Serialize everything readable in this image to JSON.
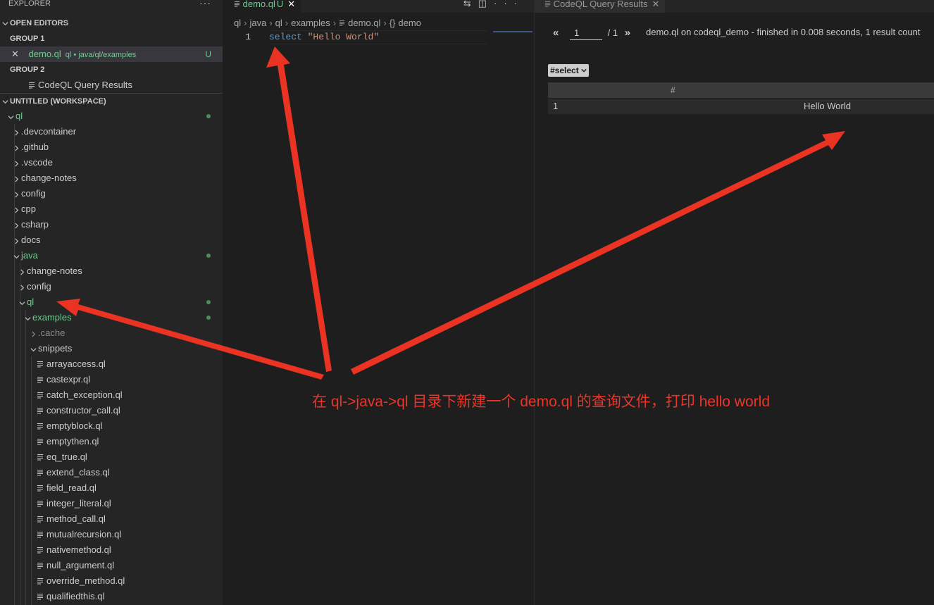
{
  "sidebar": {
    "header": "EXPLORER",
    "more": "···",
    "open_editors_label": "OPEN EDITORS",
    "group1_label": "GROUP 1",
    "group1_file": "demo.ql",
    "group1_hint": "ql • java/ql/examples",
    "group1_badge": "U",
    "group2_label": "GROUP 2",
    "group2_file": "CodeQL Query Results",
    "workspace_label": "UNTITLED (WORKSPACE)",
    "tree": [
      {
        "label": "ql"
      },
      {
        "label": ".devcontainer"
      },
      {
        "label": ".github"
      },
      {
        "label": ".vscode"
      },
      {
        "label": "change-notes"
      },
      {
        "label": "config"
      },
      {
        "label": "cpp"
      },
      {
        "label": "csharp"
      },
      {
        "label": "docs"
      },
      {
        "label": "java"
      },
      {
        "label": "change-notes"
      },
      {
        "label": "config"
      },
      {
        "label": "ql"
      },
      {
        "label": "examples"
      },
      {
        "label": ".cache"
      },
      {
        "label": "snippets"
      },
      {
        "label": "arrayaccess.ql"
      },
      {
        "label": "castexpr.ql"
      },
      {
        "label": "catch_exception.ql"
      },
      {
        "label": "constructor_call.ql"
      },
      {
        "label": "emptyblock.ql"
      },
      {
        "label": "emptythen.ql"
      },
      {
        "label": "eq_true.ql"
      },
      {
        "label": "extend_class.ql"
      },
      {
        "label": "field_read.ql"
      },
      {
        "label": "integer_literal.ql"
      },
      {
        "label": "method_call.ql"
      },
      {
        "label": "mutualrecursion.ql"
      },
      {
        "label": "nativemethod.ql"
      },
      {
        "label": "null_argument.ql"
      },
      {
        "label": "override_method.ql"
      },
      {
        "label": "qualifiedthis.ql"
      }
    ]
  },
  "editor": {
    "tab_name": "demo.ql",
    "tab_badge": "U",
    "breadcrumbs": [
      "ql",
      "java",
      "ql",
      "examples",
      "demo.ql",
      "demo"
    ],
    "line_number": "1",
    "code_keyword": "select",
    "code_string": "\"Hello World\""
  },
  "results": {
    "tab_label": "CodeQL Query Results",
    "page_value": "1",
    "page_total": "/ 1",
    "status": "demo.ql on codeql_demo - finished in 0.008 seconds, 1 result count",
    "result_set": "#select",
    "columns": [
      "#",
      ""
    ],
    "rows": [
      {
        "index": "1",
        "value": "Hello World"
      }
    ]
  },
  "annotation": {
    "text": "在 ql->java->ql 目录下新建一个 demo.ql 的查询文件，打印 hello world",
    "color": "#e8362a"
  }
}
